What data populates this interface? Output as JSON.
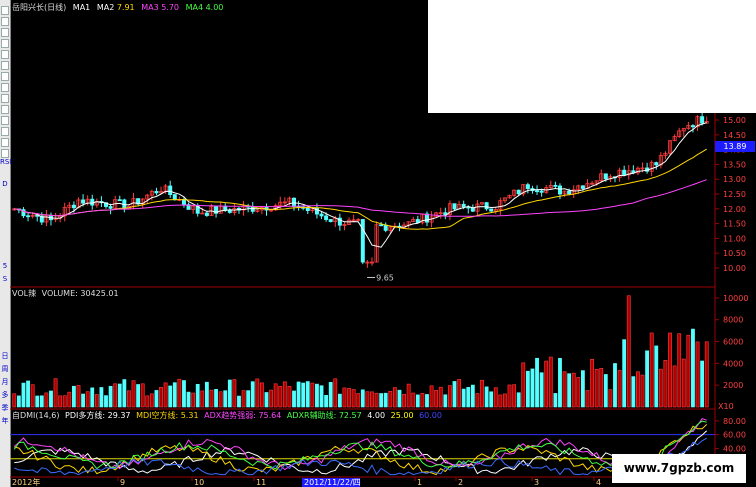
{
  "price_panel": {
    "title": "岳阳兴长(日线)",
    "ma_labels": [
      "MA1",
      "MA2",
      "MA3",
      "MA4"
    ],
    "ma_values": [
      "",
      "7.91",
      "5.70",
      "4.00"
    ],
    "ma_colors": [
      "#ffffff",
      "#ffd700",
      "#ff44ff",
      "#44ff44"
    ],
    "current_price_tag": "13.89",
    "low_marker": "9.65",
    "y_ticks": [
      "15.00",
      "14.50",
      "14.00",
      "13.50",
      "13.00",
      "12.50",
      "12.00",
      "11.50",
      "11.00",
      "10.50",
      "10.00"
    ]
  },
  "volume_panel": {
    "title": "VOL辣",
    "volume_label": "VOLUME: 30425.01",
    "y_ticks": [
      "10000",
      "8000",
      "6000",
      "4000",
      "2000"
    ],
    "unit": "X10"
  },
  "dmi_panel": {
    "title": "自DMI(14,6)",
    "items": [
      {
        "label": "PDI多方线: 29.37",
        "color": "#ffffff"
      },
      {
        "label": "MDI空方线: 5.31",
        "color": "#ffd700"
      },
      {
        "label": "ADX趋势强弱: 75.64",
        "color": "#ff44ff"
      },
      {
        "label": "ADXR辅助线: 72.57",
        "color": "#44ff44"
      },
      {
        "label": "4.00",
        "color": "#ffffff"
      },
      {
        "label": "25.00",
        "color": "#ffff00"
      },
      {
        "label": "60.00",
        "color": "#4444ff"
      }
    ],
    "y_ticks": [
      "80.00",
      "60.00",
      "40.00"
    ]
  },
  "date_axis": {
    "labels": [
      "2012年",
      "9",
      "10",
      "11",
      "2012/11/22/四",
      "1",
      "2",
      "3",
      "4"
    ],
    "highlight": "2012/11/22/四"
  },
  "left_toolbar": {
    "labels": [
      "RSI",
      "D",
      "5",
      "S",
      "日",
      "周",
      "月",
      "多",
      "季",
      "年"
    ]
  },
  "watermark": "www.7gpzb.com",
  "chart_data": {
    "type": "candlestick",
    "title": "岳阳兴长(日线)",
    "ylim_price": [
      9.5,
      15.2
    ],
    "price_y_ticks": [
      15.0,
      14.5,
      14.0,
      13.5,
      13.0,
      12.5,
      12.0,
      11.5,
      11.0,
      10.5,
      10.0
    ],
    "volume_ylim": [
      0,
      11000
    ],
    "volume_y_ticks": [
      10000,
      8000,
      6000,
      4000,
      2000
    ],
    "dmi_ylim": [
      0,
      90
    ],
    "dmi_y_ticks": [
      80,
      60,
      40
    ],
    "reference_lines": [
      25,
      60
    ]
  }
}
